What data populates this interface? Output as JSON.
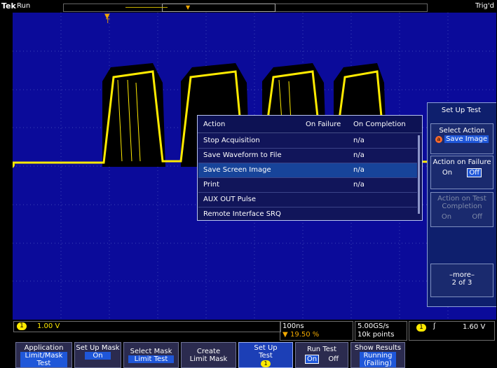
{
  "status": {
    "brand": "Tek",
    "run_state": "Run",
    "trigger_state": "Trig'd"
  },
  "markers": {
    "trigger_position_label": "T"
  },
  "side_menu": {
    "title": "Set Up Test",
    "select_action": {
      "label": "Select Action",
      "badge": "a",
      "value": "Save Image"
    },
    "action_on_failure": {
      "label": "Action on Failure",
      "on": "On",
      "off": "Off",
      "selected": "Off"
    },
    "action_on_test_completion": {
      "label": "Action on Test Completion",
      "on": "On",
      "off": "Off",
      "enabled": false
    },
    "more": {
      "label": "–more–",
      "page": "2 of 3"
    }
  },
  "popup": {
    "columns": [
      "Action",
      "On Failure",
      "On Completion"
    ],
    "rows": [
      {
        "action": "Stop Acquisition",
        "on_failure": "",
        "on_completion": "n/a"
      },
      {
        "action": "Save Waveform to File",
        "on_failure": "",
        "on_completion": "n/a"
      },
      {
        "action": "Save Screen Image",
        "on_failure": "",
        "on_completion": "n/a",
        "selected": true
      },
      {
        "action": "Print",
        "on_failure": "",
        "on_completion": "n/a"
      },
      {
        "action": "AUX OUT Pulse",
        "on_failure": "",
        "on_completion": ""
      },
      {
        "action": "Remote Interface SRQ",
        "on_failure": "",
        "on_completion": ""
      }
    ]
  },
  "readouts": {
    "channel_badge": "1",
    "channel_scale": "1.00 V",
    "timebase": "100ns",
    "trigger_offset": "19.50 %",
    "sample_rate": "5.00GS/s",
    "record_length": "10k points",
    "trigger_channel": "1",
    "trigger_level": "1.60 V"
  },
  "bottom_menu": [
    {
      "label": "Application",
      "value": "Limit/Mask Test"
    },
    {
      "label": "Set Up Mask",
      "value": "On"
    },
    {
      "label": "Select Mask",
      "value": "Limit Test"
    },
    {
      "label": "Create Limit Mask",
      "value": ""
    },
    {
      "label": "Set Up Test",
      "value": "1"
    },
    {
      "label": "Run Test",
      "on": "On",
      "off": "Off"
    },
    {
      "label": "Show Results",
      "value": "Running (Failing)"
    }
  ],
  "colors": {
    "graticule_bg": "#0b0b9a",
    "waveform": "#ffea00",
    "mask": "#000000",
    "highlight": "#1f57d9"
  }
}
